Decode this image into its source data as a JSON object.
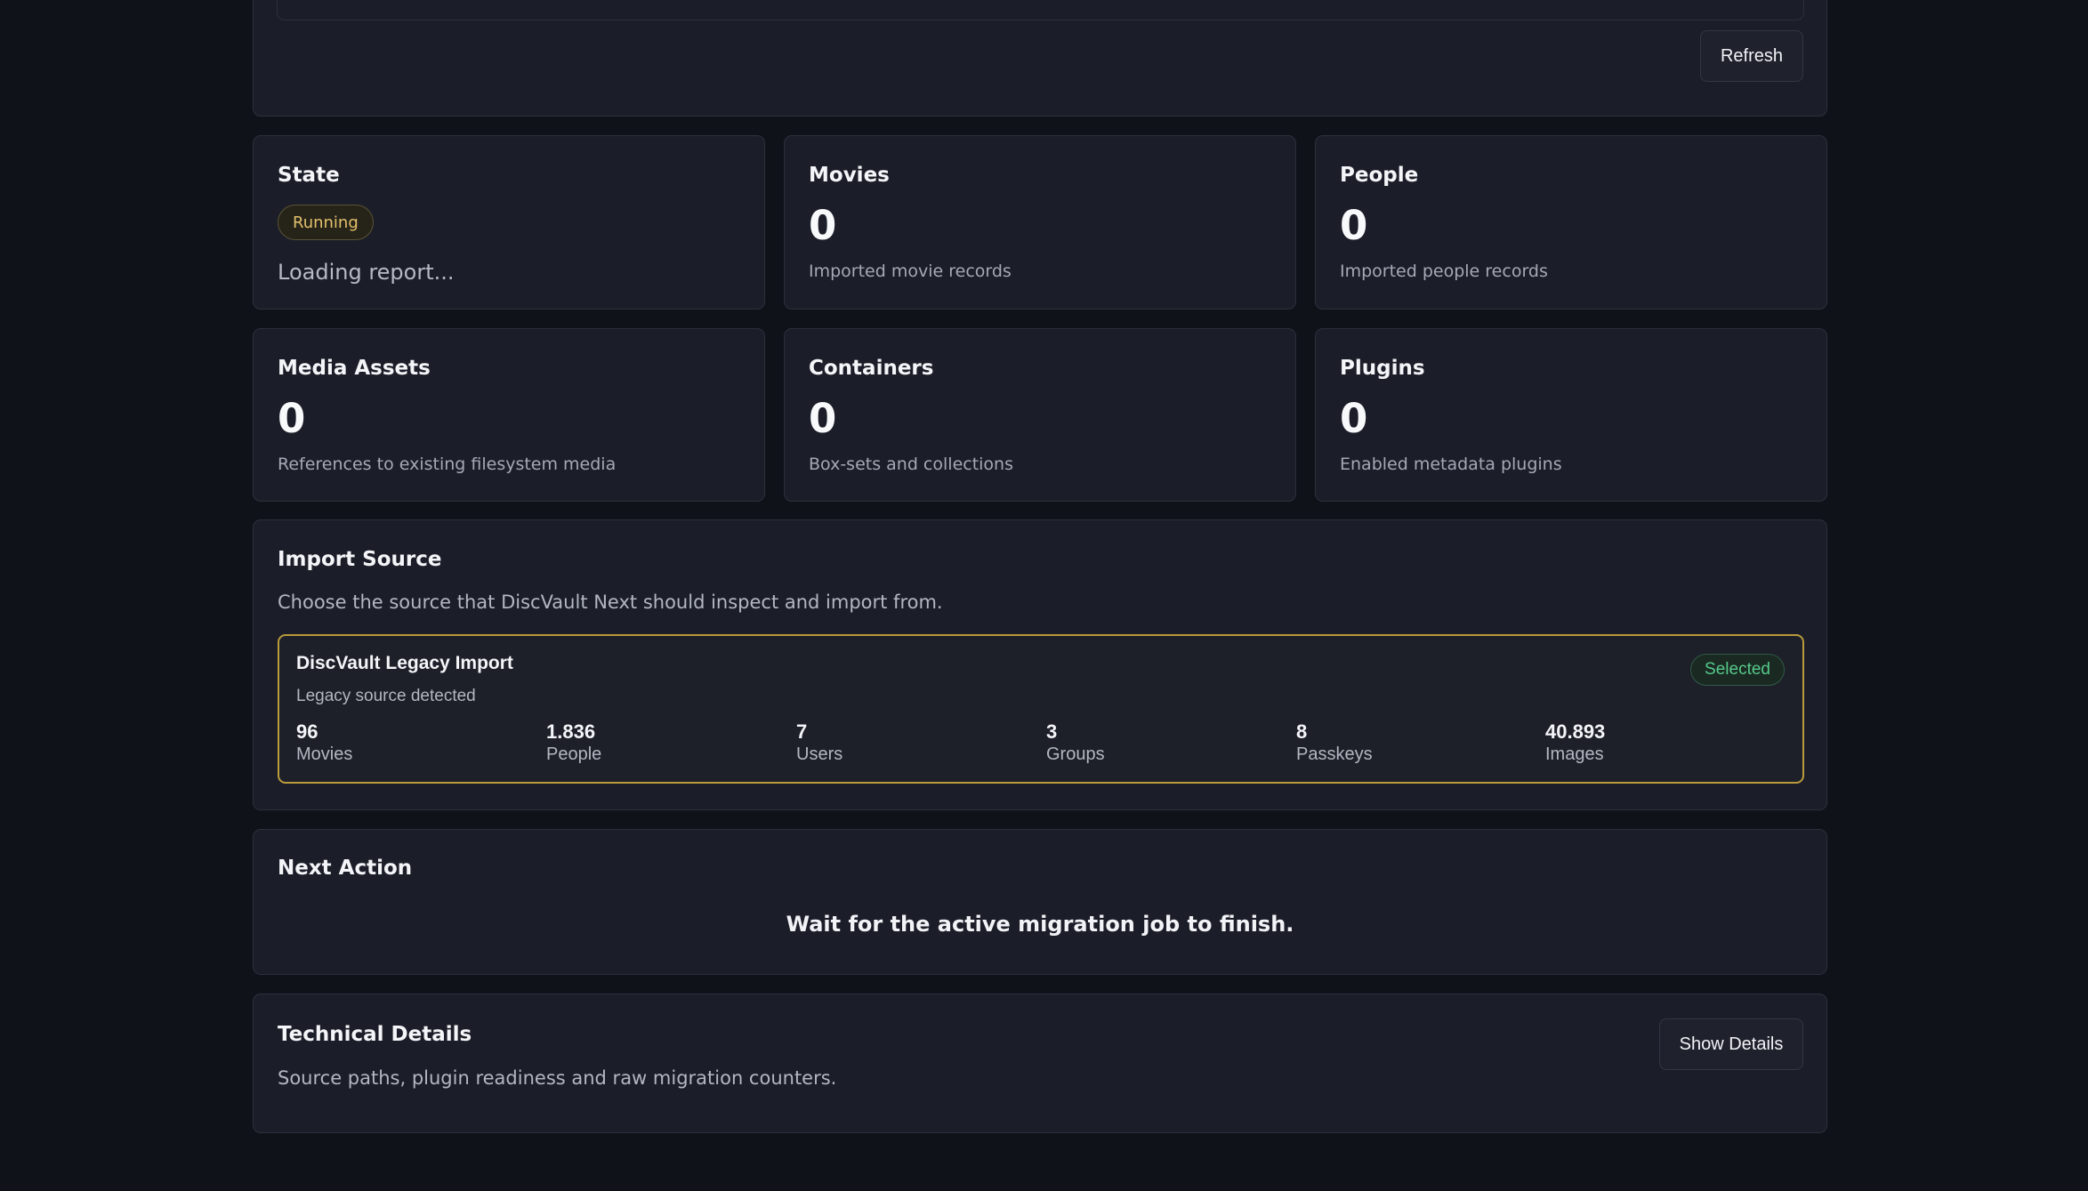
{
  "top": {
    "refresh_label": "Refresh"
  },
  "stats": {
    "state": {
      "title": "State",
      "badge": "Running",
      "status_text": "Loading report..."
    },
    "movies": {
      "title": "Movies",
      "value": "0",
      "sub": "Imported movie records"
    },
    "people": {
      "title": "People",
      "value": "0",
      "sub": "Imported people records"
    },
    "media_assets": {
      "title": "Media Assets",
      "value": "0",
      "sub": "References to existing filesystem media"
    },
    "containers": {
      "title": "Containers",
      "value": "0",
      "sub": "Box-sets and collections"
    },
    "plugins": {
      "title": "Plugins",
      "value": "0",
      "sub": "Enabled metadata plugins"
    }
  },
  "import_source": {
    "title": "Import Source",
    "description": "Choose the source that DiscVault Next should inspect and import from.",
    "source": {
      "name": "DiscVault Legacy Import",
      "status": "Legacy source detected",
      "badge": "Selected",
      "metrics": [
        {
          "value": "96",
          "label": "Movies"
        },
        {
          "value": "1.836",
          "label": "People"
        },
        {
          "value": "7",
          "label": "Users"
        },
        {
          "value": "3",
          "label": "Groups"
        },
        {
          "value": "8",
          "label": "Passkeys"
        },
        {
          "value": "40.893",
          "label": "Images"
        }
      ]
    }
  },
  "next_action": {
    "title": "Next Action",
    "message": "Wait for the active migration job to finish."
  },
  "technical_details": {
    "title": "Technical Details",
    "description": "Source paths, plugin readiness and raw migration counters.",
    "button_label": "Show Details"
  },
  "colors": {
    "background": "#10121a",
    "card": "#1b1e28",
    "running_accent": "#e3c06b",
    "selected_accent": "#56c98a",
    "source_border": "#b99a3c"
  }
}
